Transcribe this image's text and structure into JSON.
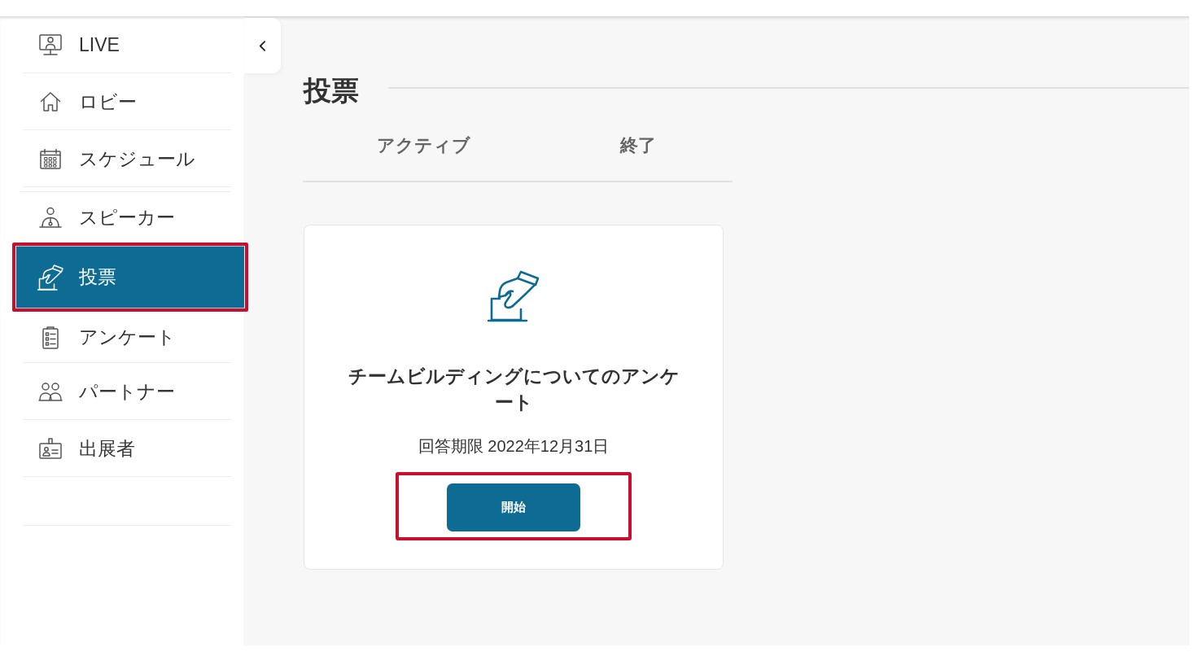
{
  "sidebar": {
    "sections": [
      {
        "items": [
          {
            "label": "LIVE",
            "selected": false,
            "highlighted": false
          },
          {
            "label": "ロビー",
            "selected": false,
            "highlighted": false
          },
          {
            "label": "スケジュール",
            "selected": false,
            "highlighted": false
          }
        ]
      },
      {
        "items": [
          {
            "label": "スピーカー",
            "selected": false,
            "highlighted": false
          },
          {
            "label": "投票",
            "selected": true,
            "highlighted": true
          },
          {
            "label": "アンケート",
            "selected": false,
            "highlighted": false
          },
          {
            "label": "パートナー",
            "selected": false,
            "highlighted": false
          },
          {
            "label": "出展者",
            "selected": false,
            "highlighted": false
          }
        ]
      }
    ]
  },
  "page": {
    "title": "投票",
    "tabs": [
      {
        "label": "アクティブ"
      },
      {
        "label": "終了"
      }
    ],
    "cards": [
      {
        "title": "チームビルディングについてのアンケート",
        "deadline": "回答期限 2022年12月31日",
        "button": {
          "label": "開始",
          "highlighted": true
        }
      }
    ]
  }
}
